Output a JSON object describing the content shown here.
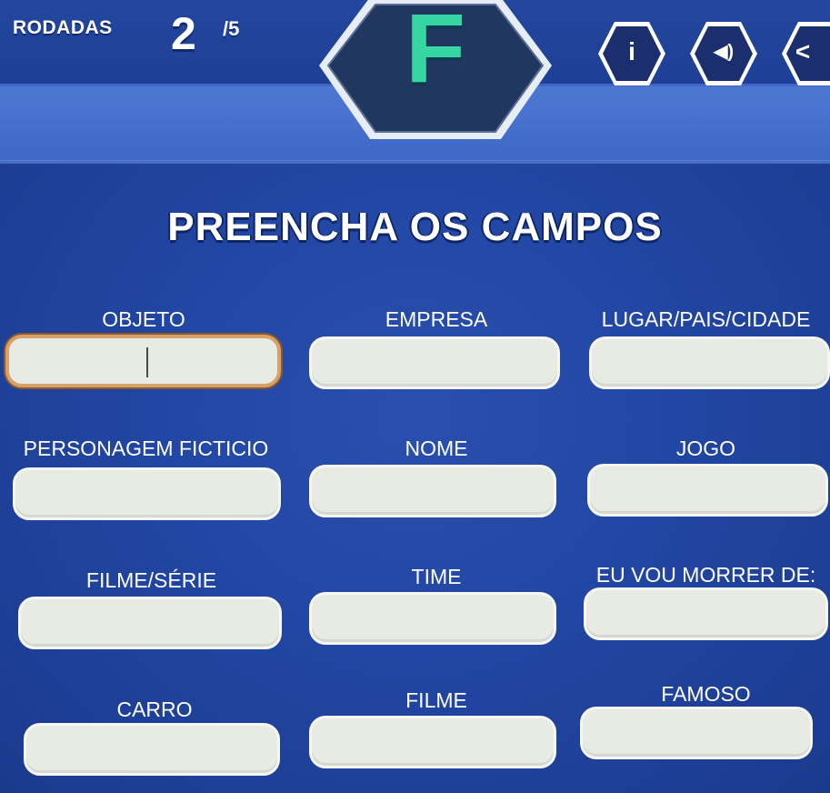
{
  "header": {
    "rounds_label": "RODADAS",
    "round_current": "2",
    "round_total": "/5",
    "letter": "F",
    "info_icon_glyph": "i",
    "sound_icon_glyph": "◀)",
    "share_icon_glyph": "<"
  },
  "title": "PREENCHA OS CAMPOS",
  "fields": [
    {
      "label": "OBJETO",
      "value": ""
    },
    {
      "label": "EMPRESA",
      "value": ""
    },
    {
      "label": "LUGAR/PAIS/CIDADE",
      "value": ""
    },
    {
      "label": "PERSONAGEM FICTICIO",
      "value": ""
    },
    {
      "label": "NOME",
      "value": ""
    },
    {
      "label": "JOGO",
      "value": ""
    },
    {
      "label": "FILME/SÉRIE",
      "value": ""
    },
    {
      "label": "TIME",
      "value": ""
    },
    {
      "label": "EU VOU MORRER DE:",
      "value": ""
    },
    {
      "label": "CARRO",
      "value": ""
    },
    {
      "label": "FILME",
      "value": ""
    },
    {
      "label": "FAMOSO",
      "value": ""
    }
  ],
  "colors": {
    "background": "#1f3f9c",
    "accent_letter": "#35d6a1",
    "input_fill": "#e8ebe3",
    "active_border": "#d8a169"
  }
}
